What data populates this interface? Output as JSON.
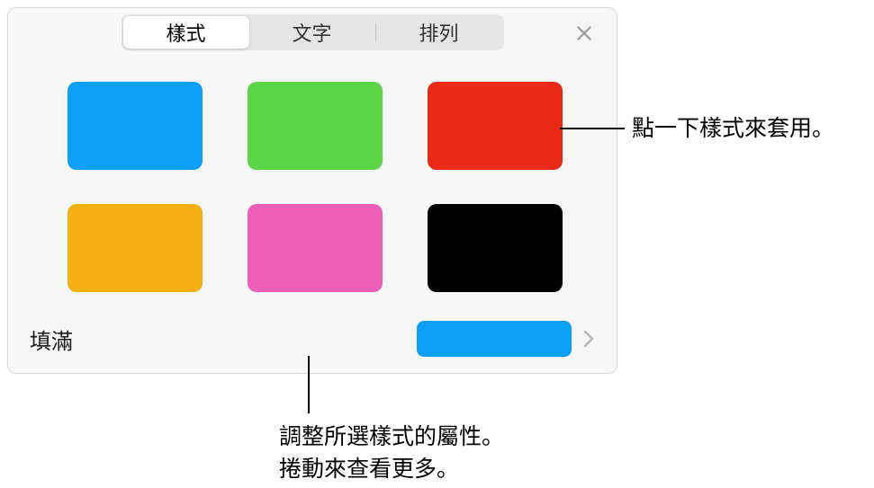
{
  "tabs": {
    "style": "樣式",
    "text": "文字",
    "arrange": "排列"
  },
  "swatches": [
    {
      "name": "blue",
      "color": "#0b9ff6"
    },
    {
      "name": "green",
      "color": "#5cd646"
    },
    {
      "name": "red",
      "color": "#ea2916"
    },
    {
      "name": "orange",
      "color": "#f3af13"
    },
    {
      "name": "pink",
      "color": "#ed5fb7"
    },
    {
      "name": "black",
      "color": "#000000"
    }
  ],
  "fill": {
    "label": "填滿",
    "color": "#0b9ff6"
  },
  "callouts": {
    "apply": "點一下樣式來套用。",
    "adjust_line1": "調整所選樣式的屬性。",
    "adjust_line2": "捲動來查看更多。"
  }
}
